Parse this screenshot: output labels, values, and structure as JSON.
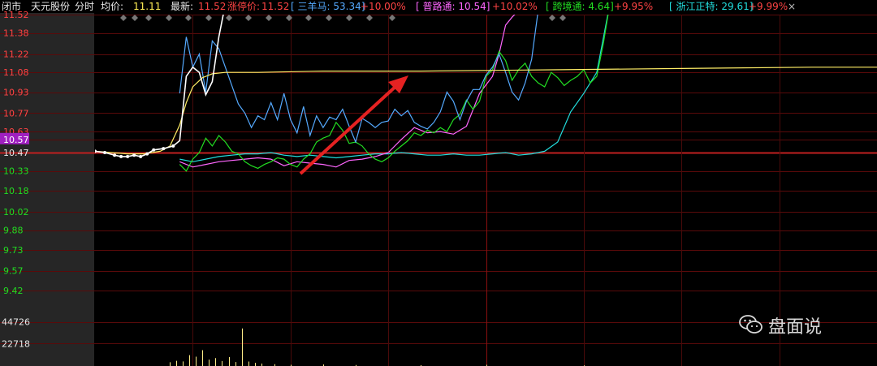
{
  "header": {
    "status": "闭市",
    "stock_name": "天元股份",
    "mode": "分时",
    "avg_label": "均价:",
    "avg_value": "11.11",
    "latest_label": "最新:",
    "latest_value": "11.52",
    "limit_label": "涨停价:",
    "limit_value": "11.52",
    "refs": [
      {
        "name": "[ 三羊马: 53.34]",
        "pct": "+10.00%",
        "color": "#55aaff"
      },
      {
        "name": "[ 普路通: 10.54]",
        "pct": "+10.02%",
        "color": "#ff66ff"
      },
      {
        "name": "[ 跨境通: 4.64]",
        "pct": "+9.95%",
        "color": "#22dd22"
      },
      {
        "name": "[ 浙江正特: 29.61]",
        "pct": "+9.99%",
        "color": "#22dddd"
      }
    ],
    "close_symbol": "×"
  },
  "watermark": {
    "text": "盘面说",
    "icon": "wechat-icon"
  },
  "chart_data": {
    "type": "line",
    "title": "",
    "price_ticks": [
      "11.52",
      "11.38",
      "11.22",
      "11.08",
      "10.93",
      "10.77",
      "10.63",
      "10.57",
      "10.47",
      "10.33",
      "10.18",
      "10.02",
      "9.88",
      "9.73",
      "9.57",
      "9.42"
    ],
    "prev_close": 10.47,
    "current_price_marker": 10.57,
    "volume_ticks": [
      "44726",
      "22718"
    ],
    "ylim": [
      9.42,
      11.52
    ],
    "volume_ylim": [
      0,
      60000
    ],
    "grid": true,
    "x_minutes": 240,
    "series": [
      {
        "key": "stock",
        "color": "#ffffff",
        "x": [
          0,
          3,
          6,
          8,
          10,
          12,
          14,
          16,
          18,
          21,
          24,
          26,
          28,
          30,
          32,
          34,
          36,
          38,
          40,
          42,
          44
        ],
        "values": [
          10.48,
          10.47,
          10.45,
          10.44,
          10.44,
          10.45,
          10.44,
          10.46,
          10.49,
          10.5,
          10.52,
          10.56,
          11.05,
          11.12,
          11.08,
          10.91,
          11.01,
          11.35,
          11.6,
          11.8,
          11.9
        ]
      },
      {
        "key": "avg",
        "color": "#ffee66",
        "x": [
          0,
          5,
          10,
          15,
          20,
          23,
          26,
          28,
          30,
          33,
          36,
          40,
          50,
          70,
          100,
          140,
          180,
          220,
          240
        ],
        "values": [
          10.48,
          10.47,
          10.46,
          10.46,
          10.48,
          10.52,
          10.68,
          10.85,
          10.97,
          11.04,
          11.07,
          11.08,
          11.08,
          11.09,
          11.09,
          11.1,
          11.11,
          11.12,
          11.12
        ]
      },
      {
        "key": "ref1",
        "color": "#55aaff",
        "x": [
          26,
          28,
          30,
          32,
          34,
          36,
          38,
          40,
          42,
          44,
          46,
          48,
          50,
          52,
          54,
          56,
          58,
          60,
          62,
          64,
          66,
          68,
          70,
          72,
          74,
          76,
          78,
          80,
          82,
          84,
          86,
          88,
          90,
          92,
          94,
          96,
          98,
          100,
          102,
          104,
          106,
          108,
          110,
          112,
          114,
          116,
          118,
          120,
          122,
          124,
          126,
          128,
          130,
          132,
          134,
          136,
          138,
          140,
          142
        ],
        "values": [
          10.92,
          11.35,
          11.12,
          11.22,
          10.93,
          11.32,
          11.26,
          11.12,
          10.98,
          10.84,
          10.77,
          10.66,
          10.75,
          10.72,
          10.85,
          10.72,
          10.92,
          10.72,
          10.62,
          10.82,
          10.6,
          10.75,
          10.66,
          10.74,
          10.72,
          10.8,
          10.67,
          10.55,
          10.73,
          10.7,
          10.66,
          10.7,
          10.71,
          10.8,
          10.75,
          10.79,
          10.7,
          10.67,
          10.65,
          10.7,
          10.78,
          10.93,
          10.86,
          10.72,
          10.86,
          10.95,
          10.95,
          11.06,
          11.12,
          11.22,
          11.08,
          10.93,
          10.87,
          11.0,
          11.18,
          11.55,
          11.9,
          12.1,
          12.2
        ]
      },
      {
        "key": "ref2",
        "color": "#ff66ff",
        "x": [
          26,
          30,
          34,
          38,
          42,
          46,
          50,
          54,
          58,
          62,
          66,
          70,
          74,
          78,
          82,
          86,
          90,
          94,
          98,
          102,
          106,
          110,
          114,
          118,
          122,
          124,
          126,
          128,
          130,
          132,
          134,
          136,
          138,
          140,
          142
        ],
        "values": [
          10.4,
          10.36,
          10.38,
          10.4,
          10.41,
          10.42,
          10.43,
          10.42,
          10.37,
          10.4,
          10.39,
          10.38,
          10.36,
          10.41,
          10.42,
          10.44,
          10.47,
          10.57,
          10.66,
          10.62,
          10.63,
          10.61,
          10.67,
          10.92,
          11.05,
          11.22,
          11.44,
          11.5,
          11.55,
          11.6,
          11.65,
          11.7,
          11.8,
          11.9,
          12.0
        ]
      },
      {
        "key": "ref3",
        "color": "#22dd22",
        "x": [
          26,
          28,
          30,
          32,
          34,
          36,
          38,
          40,
          42,
          44,
          46,
          48,
          50,
          52,
          54,
          56,
          58,
          60,
          62,
          64,
          66,
          68,
          70,
          72,
          74,
          76,
          78,
          80,
          82,
          84,
          86,
          88,
          90,
          92,
          94,
          96,
          98,
          100,
          102,
          104,
          106,
          108,
          110,
          112,
          114,
          116,
          118,
          120,
          122,
          124,
          126,
          128,
          130,
          132,
          134,
          136,
          138,
          140,
          142,
          144,
          146,
          148,
          150,
          152,
          154,
          156,
          158
        ],
        "values": [
          10.38,
          10.33,
          10.42,
          10.47,
          10.58,
          10.52,
          10.6,
          10.55,
          10.48,
          10.46,
          10.4,
          10.37,
          10.35,
          10.38,
          10.4,
          10.43,
          10.42,
          10.38,
          10.36,
          10.42,
          10.46,
          10.55,
          10.58,
          10.6,
          10.7,
          10.64,
          10.54,
          10.55,
          10.52,
          10.46,
          10.42,
          10.4,
          10.43,
          10.48,
          10.52,
          10.56,
          10.62,
          10.6,
          10.64,
          10.62,
          10.66,
          10.63,
          10.72,
          10.76,
          10.87,
          10.8,
          10.86,
          11.05,
          11.1,
          11.24,
          11.17,
          11.02,
          11.1,
          11.15,
          11.05,
          11.0,
          10.97,
          11.08,
          11.04,
          10.98,
          11.02,
          11.05,
          11.1,
          11.0,
          11.05,
          11.3,
          11.6
        ]
      },
      {
        "key": "ref4",
        "color": "#22dddd",
        "x": [
          26,
          30,
          34,
          38,
          42,
          46,
          50,
          54,
          58,
          62,
          66,
          70,
          74,
          78,
          82,
          86,
          90,
          94,
          98,
          102,
          106,
          110,
          114,
          118,
          122,
          126,
          130,
          134,
          138,
          142,
          146,
          150,
          154,
          158
        ],
        "values": [
          10.42,
          10.4,
          10.42,
          10.44,
          10.45,
          10.46,
          10.46,
          10.47,
          10.45,
          10.44,
          10.45,
          10.44,
          10.43,
          10.44,
          10.45,
          10.46,
          10.46,
          10.47,
          10.46,
          10.45,
          10.45,
          10.46,
          10.45,
          10.45,
          10.46,
          10.47,
          10.45,
          10.46,
          10.48,
          10.55,
          10.78,
          10.92,
          11.08,
          11.6
        ]
      }
    ],
    "volume": {
      "x": [
        23,
        25,
        27,
        29,
        31,
        33,
        35,
        37,
        39,
        41,
        43,
        45,
        47,
        49,
        51,
        55,
        60,
        70,
        80,
        100,
        120,
        150
      ],
      "values": [
        3800,
        5200,
        4600,
        11000,
        9500,
        16000,
        6500,
        8000,
        5000,
        9000,
        4000,
        38000,
        4500,
        3200,
        2500,
        1800,
        1200,
        1500,
        1000,
        800,
        1200,
        600
      ]
    }
  }
}
